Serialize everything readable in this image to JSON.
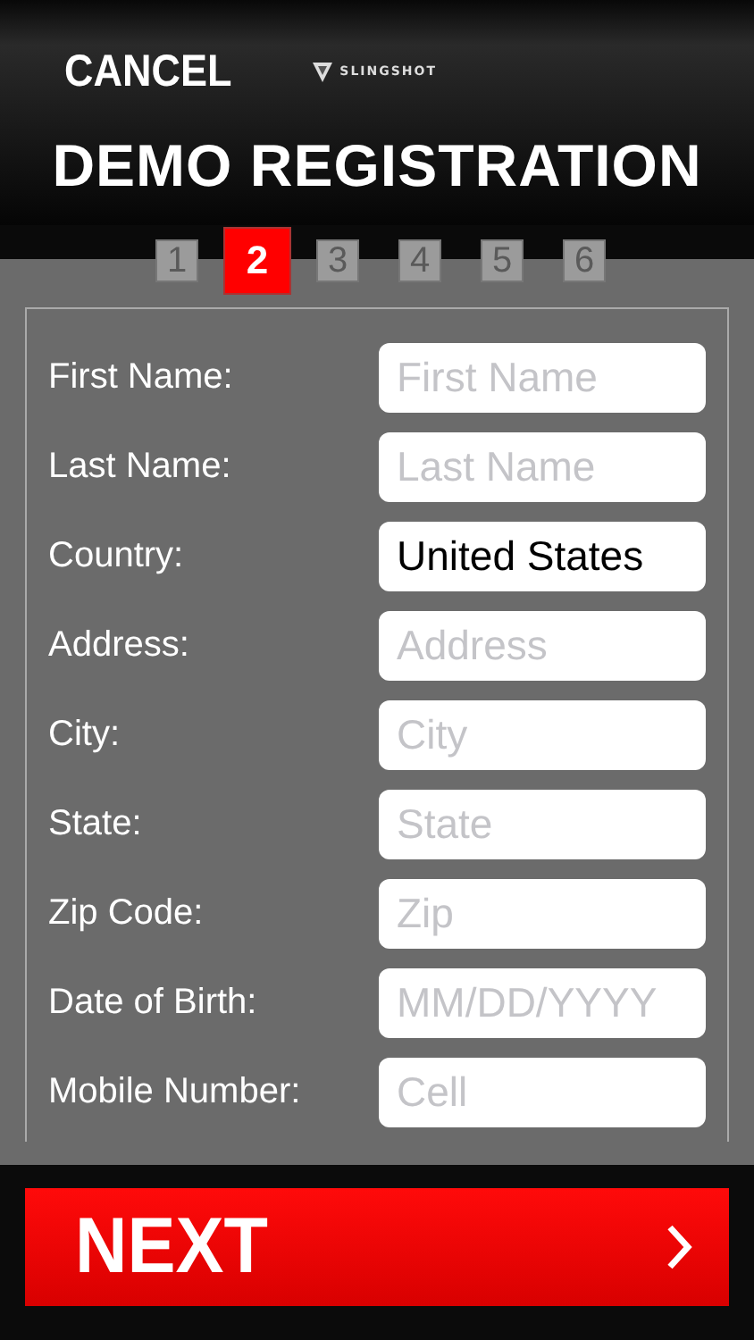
{
  "header": {
    "cancel": "CANCEL",
    "logo": "SLINGSHOT",
    "title": "DEMO REGISTRATION"
  },
  "steps": [
    {
      "label": "1",
      "selected": false
    },
    {
      "label": "2",
      "selected": true
    },
    {
      "label": "3",
      "selected": false
    },
    {
      "label": "4",
      "selected": false
    },
    {
      "label": "5",
      "selected": false
    },
    {
      "label": "6",
      "selected": false
    }
  ],
  "fields": [
    {
      "label": "First Name:",
      "placeholder": "First Name"
    },
    {
      "label": "Last Name:",
      "placeholder": "Last Name"
    },
    {
      "label": "Country:",
      "value": "United States"
    },
    {
      "label": "Address:",
      "placeholder": "Address"
    },
    {
      "label": "City:",
      "placeholder": "City"
    },
    {
      "label": "State:",
      "placeholder": "State"
    },
    {
      "label": "Zip Code:",
      "placeholder": "Zip"
    },
    {
      "label": "Date of Birth:",
      "placeholder": "MM/DD/YYYY"
    },
    {
      "label": "Mobile Number:",
      "placeholder": "Cell"
    }
  ],
  "next": {
    "label": "NEXT"
  }
}
